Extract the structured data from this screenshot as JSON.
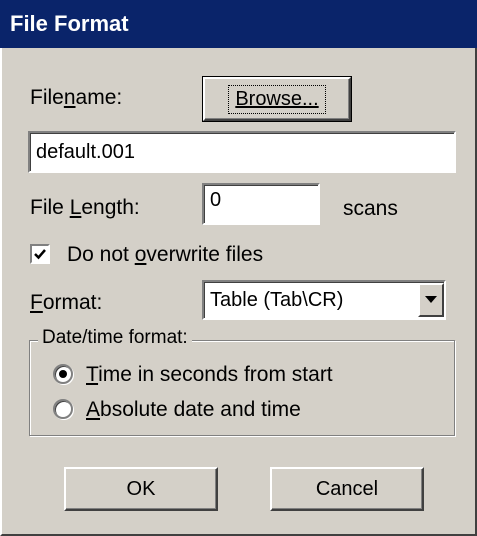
{
  "window": {
    "title": "File Format"
  },
  "filename": {
    "label_pre": "File",
    "label_accel": "n",
    "label_post": "ame:",
    "browse_label": "Browse...",
    "value": "default.001"
  },
  "file_length": {
    "label_pre": "File ",
    "label_accel": "L",
    "label_post": "ength:",
    "value": "0",
    "unit": "scans"
  },
  "overwrite": {
    "label_pre": "Do not ",
    "label_accel": "o",
    "label_post": "verwrite files",
    "checked": true
  },
  "format": {
    "label_accel": "F",
    "label_post": "ormat:",
    "selected": "Table (Tab\\CR)"
  },
  "datetime": {
    "legend": "Date/time format:",
    "options": [
      {
        "accel": "T",
        "rest": "ime in seconds from start",
        "selected": true
      },
      {
        "accel": "A",
        "rest": "bsolute date and time",
        "selected": false
      }
    ]
  },
  "buttons": {
    "ok": "OK",
    "cancel": "Cancel"
  }
}
